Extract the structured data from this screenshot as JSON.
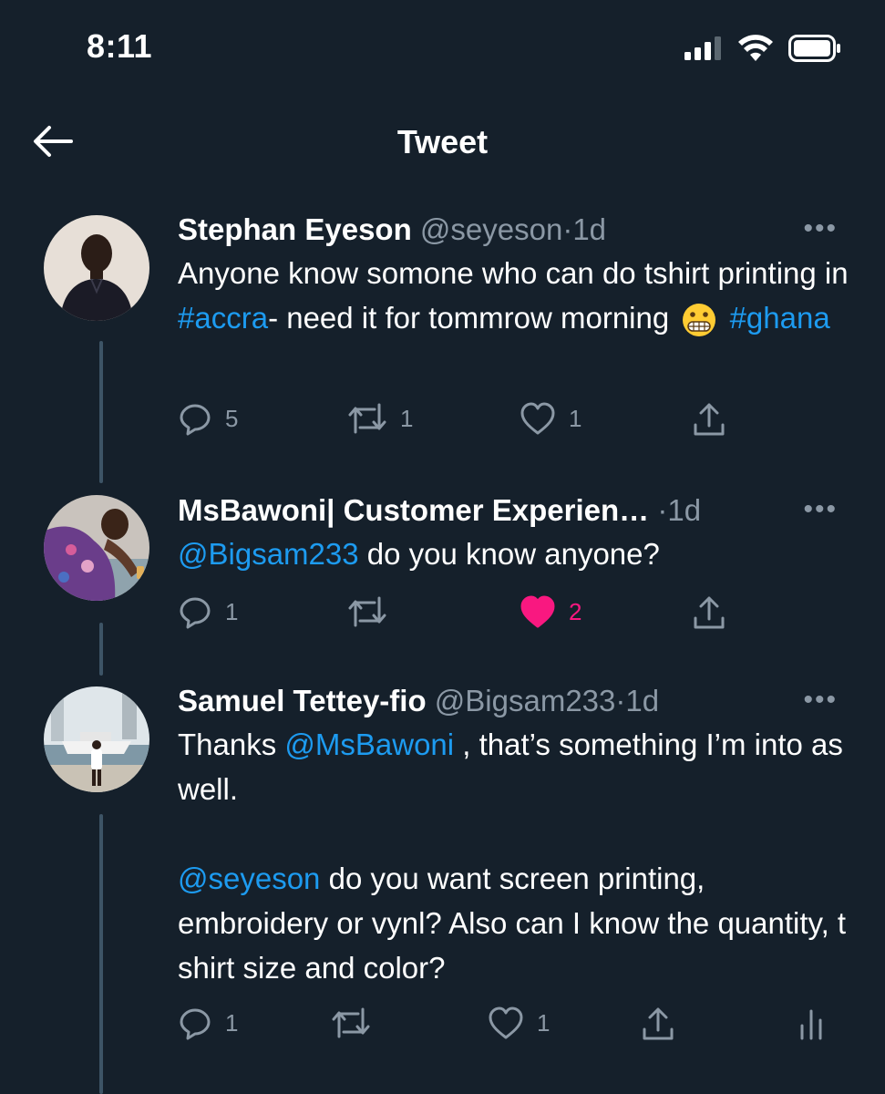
{
  "status_bar": {
    "time": "8:11"
  },
  "nav": {
    "title": "Tweet"
  },
  "tweets": [
    {
      "name": "Stephan Eyeson",
      "handle": "@seyeson",
      "sep": "·",
      "time_ago": "1d",
      "text_parts": [
        "Anyone know somone who can do tshirt printing in ",
        "#accra",
        "- need it for tommrow morning ",
        "#ghana"
      ],
      "actions": {
        "replies": "5",
        "retweets": "1",
        "likes": "1"
      }
    },
    {
      "name": "MsBawoni| Customer Experien…",
      "sep": "·",
      "time_ago": "1d",
      "text_parts": [
        "@Bigsam233",
        " do you know anyone?"
      ],
      "actions": {
        "replies": "1",
        "retweets": "",
        "likes": "2"
      }
    },
    {
      "name": "Samuel Tettey-fio",
      "handle": "@Bigsam233",
      "sep": "·",
      "time_ago": "1d",
      "text_parts": [
        "Thanks ",
        "@MsBawoni",
        " , that’s something I’m into as well.",
        "@seyeson",
        " do you want screen printing, embroidery or vynl? Also can I know the quantity, t shirt size and color?"
      ],
      "actions": {
        "replies": "1",
        "retweets": "",
        "likes": "1"
      }
    }
  ],
  "colors": {
    "background": "#15202b",
    "link": "#1d9bf0",
    "muted": "#8b98a5",
    "like": "#f91880"
  }
}
